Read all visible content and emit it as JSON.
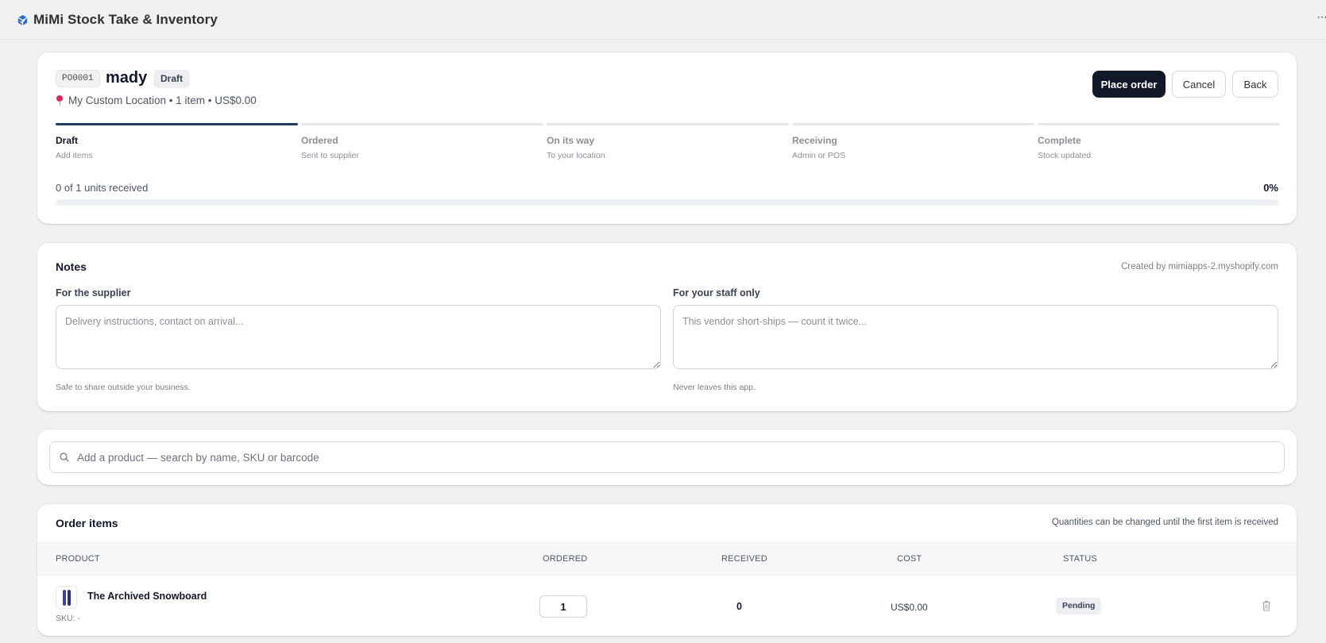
{
  "app": {
    "title": "MiMi Stock Take & Inventory",
    "logo_icon": "cube-logo-icon",
    "more_icon": "more-dots-icon"
  },
  "order": {
    "po_number": "PO0001",
    "name": "mady",
    "status": "Draft",
    "meta": "My Custom Location • 1 item • US$0.00",
    "actions": {
      "place_order": "Place order",
      "cancel": "Cancel",
      "back": "Back"
    },
    "steps": [
      {
        "label": "Draft",
        "sub": "Add items"
      },
      {
        "label": "Ordered",
        "sub": "Sent to supplier"
      },
      {
        "label": "On its way",
        "sub": "To your location"
      },
      {
        "label": "Receiving",
        "sub": "Admin or POS"
      },
      {
        "label": "Complete",
        "sub": "Stock updated"
      }
    ],
    "active_step": 0,
    "units_received_text": "0 of 1 units received",
    "percent_text": "0%",
    "progress_fraction": 0
  },
  "notes": {
    "title": "Notes",
    "created_by": "Created by mimiapps-2.myshopify.com",
    "supplier": {
      "label": "For the supplier",
      "placeholder": "Delivery instructions, contact on arrival...",
      "help": "Safe to share outside your business."
    },
    "staff": {
      "label": "For your staff only",
      "placeholder": "This vendor short-ships — count it twice...",
      "help": "Never leaves this app."
    }
  },
  "search": {
    "placeholder": "Add a product — search by name, SKU or barcode"
  },
  "items": {
    "title": "Order items",
    "note": "Quantities can be changed until the first item is received",
    "columns": {
      "product": "PRODUCT",
      "ordered": "ORDERED",
      "received": "RECEIVED",
      "cost": "COST",
      "status": "STATUS"
    },
    "rows": [
      {
        "product": "The Archived Snowboard",
        "sku": "SKU: -",
        "ordered": "1",
        "received": "0",
        "cost": "US$0.00",
        "status": "Pending"
      }
    ]
  },
  "colors": {
    "primary_button": "#111827",
    "step_active": "#1e3a5f",
    "pin": "#e0245e"
  }
}
